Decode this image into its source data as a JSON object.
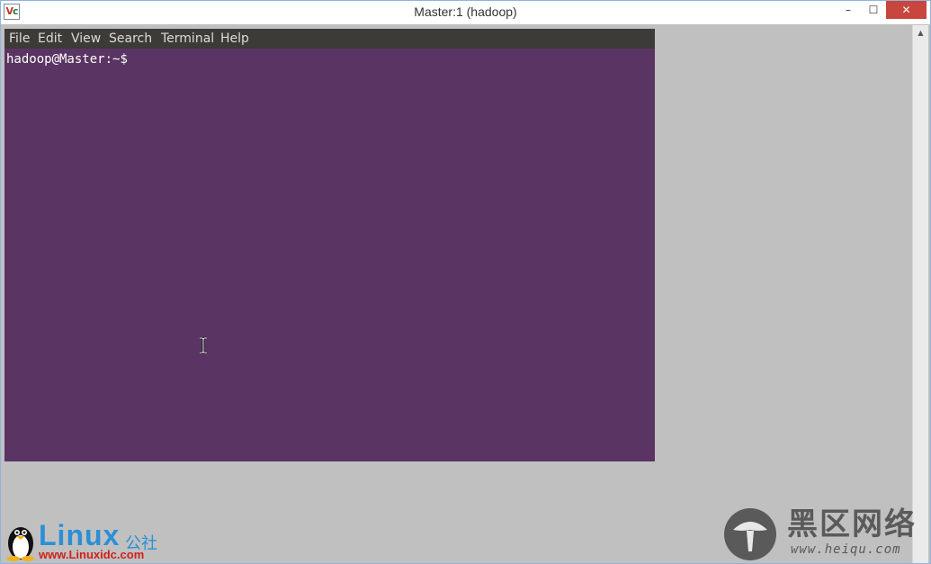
{
  "window": {
    "title": "Master:1 (hadoop)",
    "icon": "vnc-viewer-icon",
    "controls": {
      "minimize": "–",
      "maximize": "☐",
      "close": "✕"
    }
  },
  "terminal": {
    "menu": [
      "File",
      "Edit",
      "View",
      "Search",
      "Terminal",
      "Help"
    ],
    "prompt": {
      "user_host": "hadoop@Master",
      "separator": ":",
      "path": "~",
      "symbol": "$"
    },
    "background_color": "#5a3462"
  },
  "watermarks": {
    "linux": {
      "brand": "Linux",
      "suffix": "公社",
      "url": "www.Linuxidc.com"
    },
    "heiqu": {
      "name": "黑区网络",
      "url": "www.heiqu.com"
    }
  },
  "colors": {
    "menubar": "#3c3b37",
    "desktop": "#c0c0c0",
    "close_button": "#c7463e"
  }
}
